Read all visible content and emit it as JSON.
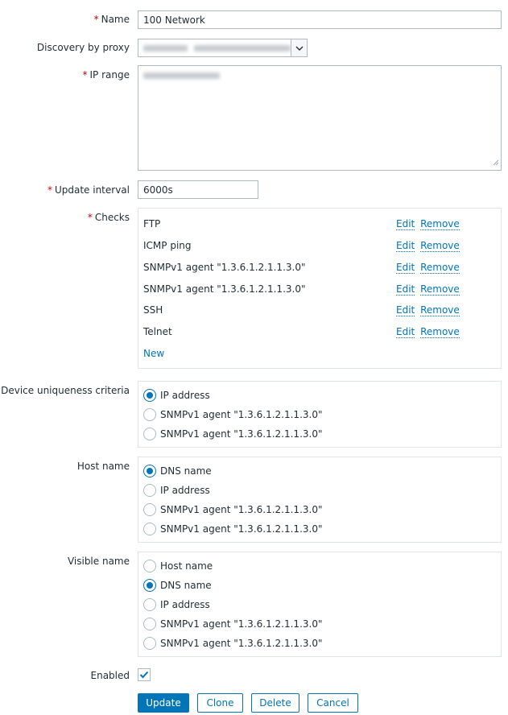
{
  "form": {
    "name_label": "Name",
    "name_value": "100 Network",
    "proxy_label": "Discovery by proxy",
    "ip_range_label": "IP range",
    "update_interval_label": "Update interval",
    "update_interval_value": "6000s",
    "checks_label": "Checks",
    "checks": [
      {
        "name": "FTP",
        "edit": "Edit",
        "remove": "Remove"
      },
      {
        "name": "ICMP ping",
        "edit": "Edit",
        "remove": "Remove"
      },
      {
        "name": "SNMPv1 agent \"1.3.6.1.2.1.1.3.0\"",
        "edit": "Edit",
        "remove": "Remove"
      },
      {
        "name": "SNMPv1 agent \"1.3.6.1.2.1.1.3.0\"",
        "edit": "Edit",
        "remove": "Remove"
      },
      {
        "name": "SSH",
        "edit": "Edit",
        "remove": "Remove"
      },
      {
        "name": "Telnet",
        "edit": "Edit",
        "remove": "Remove"
      }
    ],
    "checks_new": "New",
    "uniqueness_label": "Device uniqueness criteria",
    "uniqueness_options": [
      "IP address",
      "SNMPv1 agent \"1.3.6.1.2.1.1.3.0\"",
      "SNMPv1 agent \"1.3.6.1.2.1.1.3.0\""
    ],
    "host_name_label": "Host name",
    "host_name_options": [
      "DNS name",
      "IP address",
      "SNMPv1 agent \"1.3.6.1.2.1.1.3.0\"",
      "SNMPv1 agent \"1.3.6.1.2.1.1.3.0\""
    ],
    "visible_name_label": "Visible name",
    "visible_name_options": [
      "Host name",
      "DNS name",
      "IP address",
      "SNMPv1 agent \"1.3.6.1.2.1.1.3.0\"",
      "SNMPv1 agent \"1.3.6.1.2.1.1.3.0\""
    ],
    "enabled_label": "Enabled"
  },
  "buttons": {
    "update": "Update",
    "clone": "Clone",
    "delete": "Delete",
    "cancel": "Cancel"
  },
  "colors": {
    "accent": "#0275b8",
    "required": "#d40000"
  }
}
